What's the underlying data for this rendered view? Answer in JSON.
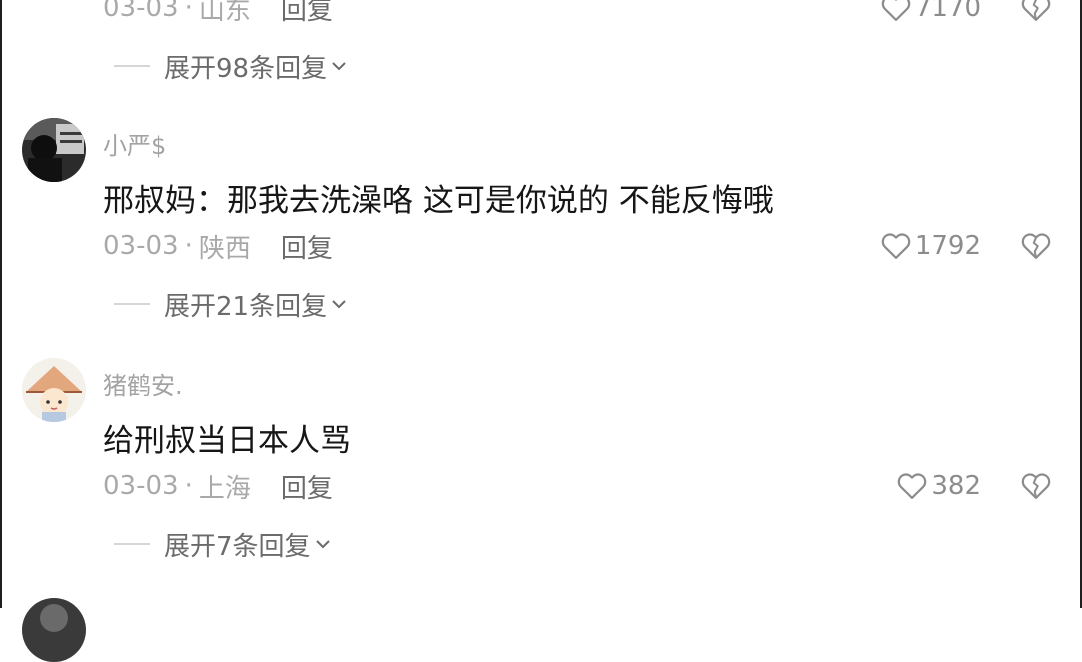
{
  "comment_top": {
    "date": "03-03",
    "location": "山东",
    "reply_label": "回复",
    "likes": "7170",
    "expand_replies": "展开98条回复"
  },
  "comments": [
    {
      "username": "小严$",
      "text": "邢叔妈：那我去洗澡咯 这可是你说的 不能反悔哦",
      "date": "03-03",
      "location": "陕西",
      "reply_label": "回复",
      "likes": "1792",
      "expand_replies": "展开21条回复"
    },
    {
      "username": "猪鹤安.",
      "text": "给刑叔当日本人骂",
      "date": "03-03",
      "location": "上海",
      "reply_label": "回复",
      "likes": "382",
      "expand_replies": "展开7条回复"
    }
  ],
  "separator": "·",
  "icons": {
    "like": "heart-outline-icon",
    "dislike": "broken-heart-icon",
    "expand": "chevron-down-icon"
  },
  "colors": {
    "text_primary": "#161616",
    "text_meta": "#a9a9a9",
    "text_reply": "#6b6b6b",
    "icon": "#8c8c8c"
  }
}
